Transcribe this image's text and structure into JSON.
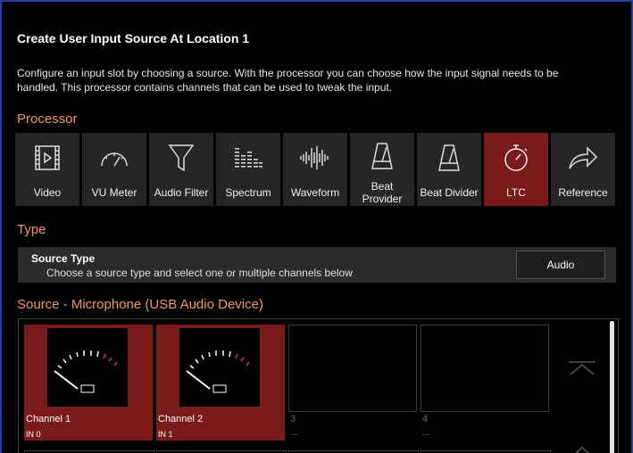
{
  "dialog": {
    "title": "Create User Input Source At Location 1",
    "description": "Configure an input slot by choosing a source. With the processor you can choose how the input signal needs to be handled. This processor contains channels that can be used to tweak the input."
  },
  "processor": {
    "heading": "Processor",
    "items": [
      {
        "label": "Video",
        "icon": "video-icon"
      },
      {
        "label": "VU Meter",
        "icon": "gauge-icon"
      },
      {
        "label": "Audio Filter",
        "icon": "funnel-icon"
      },
      {
        "label": "Spectrum",
        "icon": "spectrum-icon"
      },
      {
        "label": "Waveform",
        "icon": "waveform-icon"
      },
      {
        "label": "Beat Provider",
        "icon": "metronome-icon"
      },
      {
        "label": "Beat Divider",
        "icon": "metronome-icon"
      },
      {
        "label": "LTC",
        "icon": "stopwatch-icon",
        "selected": true
      },
      {
        "label": "Reference",
        "icon": "share-arrow-icon"
      }
    ]
  },
  "type": {
    "heading": "Type",
    "source_type_label": "Source Type",
    "source_type_hint": "Choose a source type and select one or multiple channels below",
    "source_type_value": "Audio"
  },
  "source": {
    "heading": "Source - Microphone (USB Audio Device)",
    "channels": [
      {
        "name": "Channel 1",
        "sub": "IN 0",
        "filled": true
      },
      {
        "name": "Channel 2",
        "sub": "IN 1",
        "filled": true
      },
      {
        "name": "3",
        "sub": "---",
        "filled": false
      },
      {
        "name": "4",
        "sub": "---",
        "filled": false
      }
    ]
  },
  "colors": {
    "accent": "#f29a4a",
    "selected": "#7a1a1a",
    "border": "#1f3fa8"
  }
}
